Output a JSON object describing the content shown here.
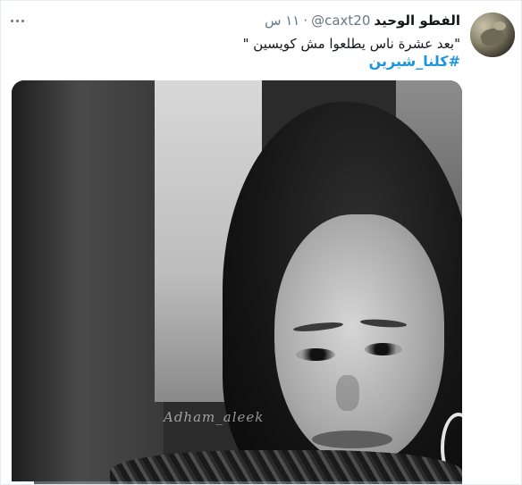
{
  "tweet": {
    "display_name": "الفطو الوحيد",
    "handle": "@caxt20",
    "separator": "·",
    "time": "١١ س",
    "text": "\"بعد عشرة ناس يطلعوا مش كويسين \"",
    "hashtag": "#كلنا_شيرين"
  },
  "media": {
    "watermark": "Adham_aleek",
    "type": "video",
    "progress": 0.05
  },
  "icons": {
    "more": "more-horizontal-icon"
  }
}
